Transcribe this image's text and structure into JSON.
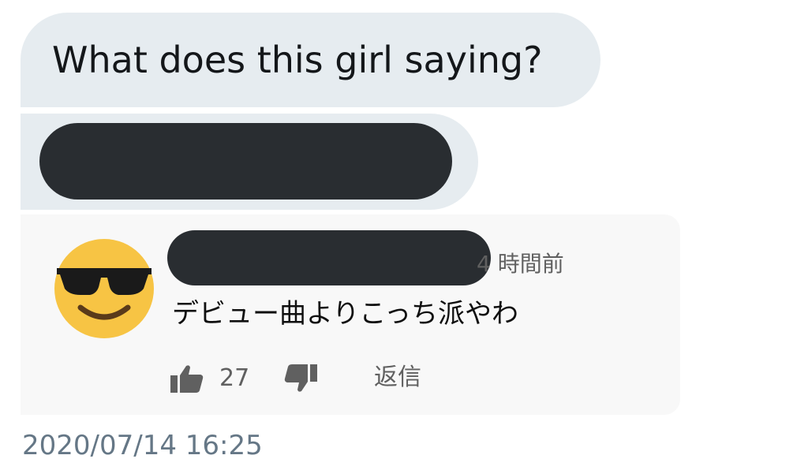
{
  "message": {
    "text": "What does this girl saying?",
    "timestamp": "2020/07/14 16:25"
  },
  "comment": {
    "time_ago": "4 時間前",
    "text": "デビュー曲よりこっち派やわ",
    "like_count": "27",
    "reply_label": "返信",
    "avatar_icon": "sunglasses-emoji-icon",
    "like_icon": "thumbs-up-icon",
    "dislike_icon": "thumbs-down-icon"
  },
  "colors": {
    "bubble": "#e6ecf0",
    "redaction": "#292d31",
    "card": "#f8f8f8",
    "timestamp": "#657786",
    "emoji": "#f7c444"
  }
}
